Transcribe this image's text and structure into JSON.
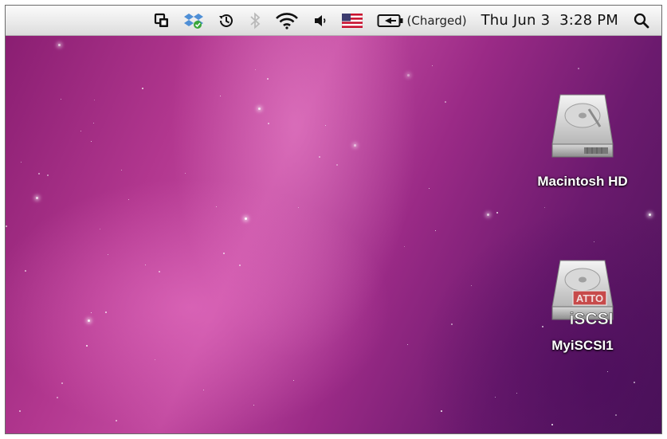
{
  "menubar": {
    "status_text": "(Charged)",
    "clock": "Thu Jun 3  3:28 PM",
    "icons": [
      "window-switch-icon",
      "dropbox-sync-icon",
      "time-machine-icon",
      "bluetooth-icon",
      "wifi-icon",
      "volume-icon",
      "us-flag-input-icon",
      "battery-icon",
      "spotlight-icon"
    ]
  },
  "desktop": {
    "drives": [
      {
        "label": "Macintosh HD",
        "icon": "hard-drive-icon"
      },
      {
        "label": "MyiSCSI1",
        "icon": "iscsi-drive-icon",
        "badge_top": "ATTO",
        "badge_bottom": "iSCSI"
      }
    ]
  },
  "colors": {
    "wallpaper_primary": "#b2378f",
    "wallpaper_dark": "#4a1458",
    "menubar": "#e9e9e9"
  }
}
